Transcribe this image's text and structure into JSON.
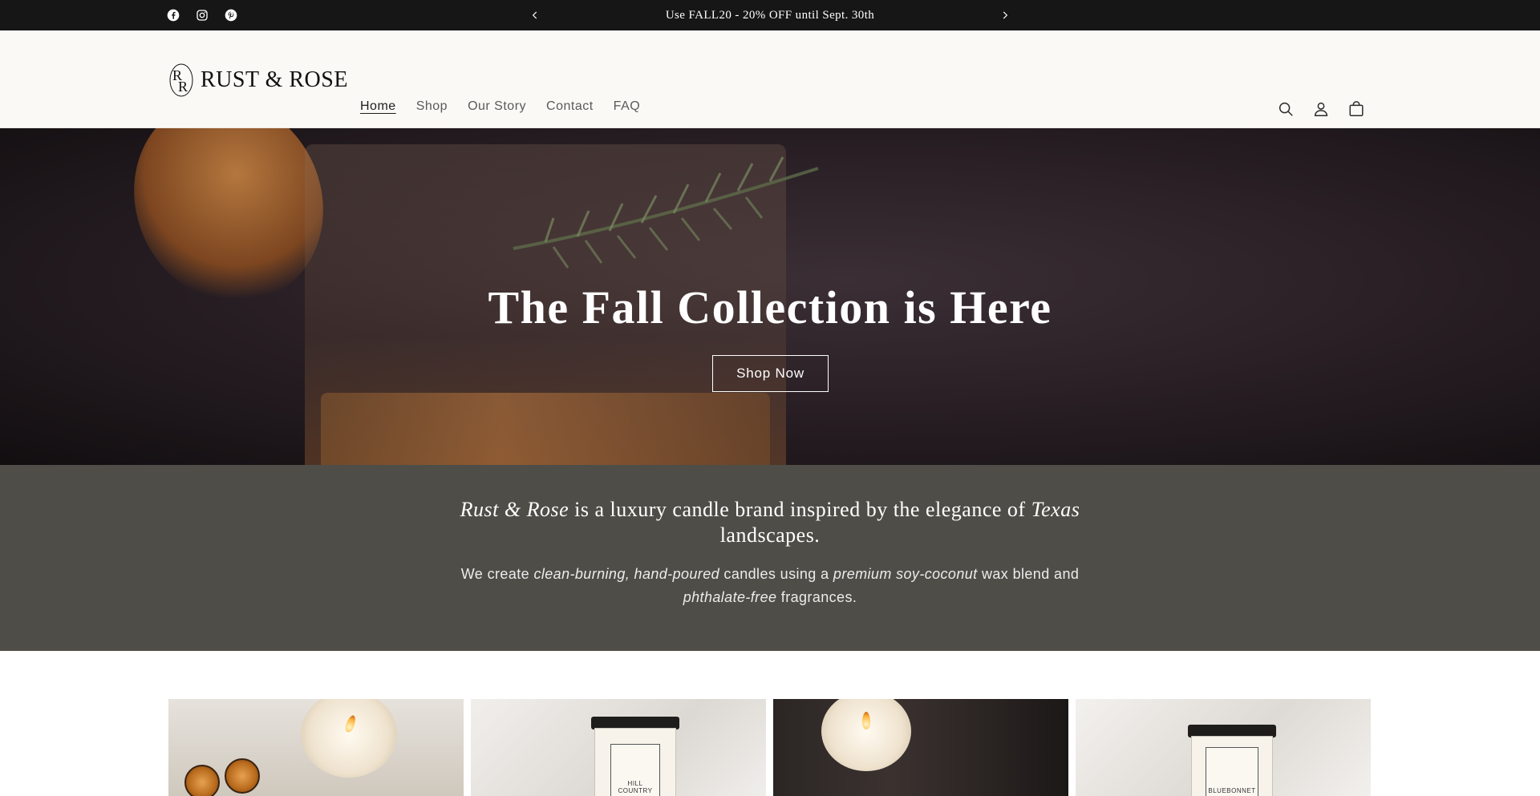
{
  "announcement": {
    "text": "Use FALL20 - 20% OFF until Sept. 30th",
    "prev_label": "Previous announcement",
    "next_label": "Next announcement"
  },
  "social": [
    {
      "name": "facebook",
      "icon": "facebook-icon"
    },
    {
      "name": "instagram",
      "icon": "instagram-icon"
    },
    {
      "name": "pinterest",
      "icon": "pinterest-icon"
    }
  ],
  "header": {
    "brand": "RUST & ROSE",
    "logo_monogram": "RR",
    "nav": [
      {
        "label": "Home",
        "active": true
      },
      {
        "label": "Shop",
        "active": false
      },
      {
        "label": "Our Story",
        "active": false
      },
      {
        "label": "Contact",
        "active": false
      },
      {
        "label": "FAQ",
        "active": false
      }
    ],
    "icons": [
      "search-icon",
      "account-icon",
      "cart-icon"
    ]
  },
  "hero": {
    "title": "The Fall Collection is Here",
    "button": "Shop Now"
  },
  "about": {
    "heading_brand": "Rust & Rose",
    "heading_mid": " is a luxury candle brand inspired by the elegance of ",
    "heading_place": "Texas",
    "heading_end": " landscapes.",
    "body_1": "We create ",
    "body_em_1": "clean-burning, hand-poured",
    "body_2": " candles using a ",
    "body_em_2": "premium soy-coconut",
    "body_3": " wax blend and ",
    "body_em_3": "phthalate-free",
    "body_4": " fragrances."
  },
  "products": [
    {
      "label": ""
    },
    {
      "label": "HILL COUNTRY"
    },
    {
      "label": ""
    },
    {
      "label": "BLUEBONNET"
    }
  ],
  "colors": {
    "announcement_bg": "#161616",
    "header_bg": "#faf9f5",
    "about_bg": "#4e4d47",
    "text": "#1f1f1f"
  }
}
